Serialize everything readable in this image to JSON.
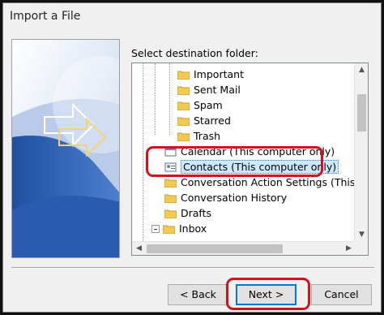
{
  "dialog": {
    "title": "Import a File",
    "prompt": "Select destination folder:"
  },
  "tree": {
    "items": [
      {
        "label": "Important",
        "icon": "folder-icon"
      },
      {
        "label": "Sent Mail",
        "icon": "folder-icon"
      },
      {
        "label": "Spam",
        "icon": "folder-icon"
      },
      {
        "label": "Starred",
        "icon": "folder-icon"
      },
      {
        "label": "Trash",
        "icon": "folder-icon"
      },
      {
        "label": "Calendar (This computer only)",
        "icon": "calendar-icon"
      },
      {
        "label": "Contacts (This computer only)",
        "icon": "contacts-icon",
        "selected": true
      },
      {
        "label": "Conversation Action Settings (This com",
        "icon": "folder-icon"
      },
      {
        "label": "Conversation History",
        "icon": "folder-icon"
      },
      {
        "label": "Drafts",
        "icon": "folder-icon"
      },
      {
        "label": "Inbox",
        "icon": "folder-icon",
        "expandable": true
      }
    ]
  },
  "buttons": {
    "back": "< Back",
    "next": "Next >",
    "cancel": "Cancel"
  },
  "colors": {
    "highlight": "#d1141a",
    "selection": "#cce8ff",
    "folder": "#f5c851"
  }
}
